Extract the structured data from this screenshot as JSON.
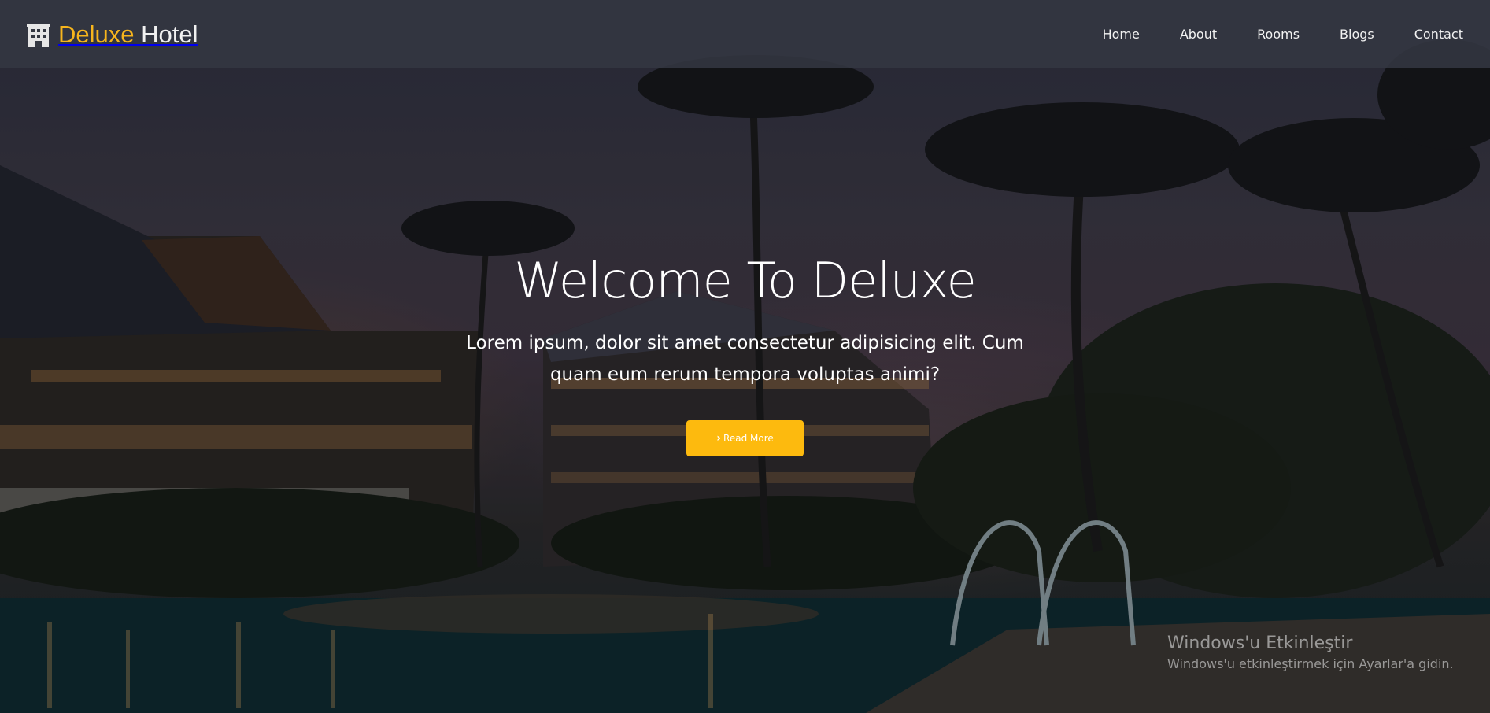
{
  "brand": {
    "word1": "Deluxe",
    "word2": "Hotel",
    "icon": "hotel-building-icon",
    "accent": "#f7b51d"
  },
  "nav": {
    "items": [
      {
        "label": "Home"
      },
      {
        "label": "About"
      },
      {
        "label": "Rooms"
      },
      {
        "label": "Blogs"
      },
      {
        "label": "Contact"
      }
    ]
  },
  "hero": {
    "title": "Welcome To Deluxe",
    "text": "Lorem ipsum, dolor sit amet consectetur adipisicing elit. Cum quam eum rerum tempora voluptas animi?",
    "button_label": "Read More",
    "button_icon": "chevron-right-icon",
    "button_color": "#fdba0e"
  },
  "watermark": {
    "title": "Windows'u Etkinleştir",
    "subtitle": "Windows'u etkinleştirmek için Ayarlar'a gidin."
  }
}
